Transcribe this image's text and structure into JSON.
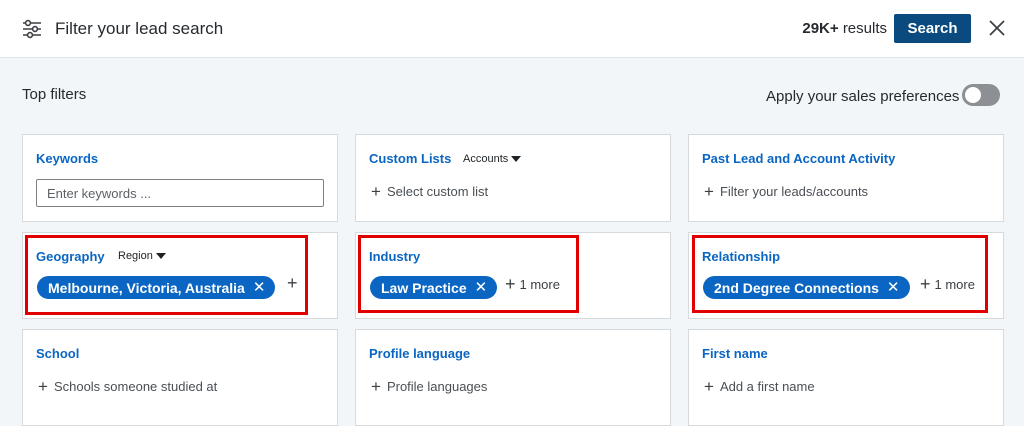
{
  "header": {
    "title": "Filter your lead search",
    "results_count": "29K+",
    "results_label": "results",
    "search_label": "Search"
  },
  "top": {
    "top_filters_label": "Top filters",
    "preferences_label": "Apply your sales preferences",
    "preferences_on": false
  },
  "cards": {
    "keywords": {
      "title": "Keywords",
      "placeholder": "Enter keywords ..."
    },
    "custom_lists": {
      "title": "Custom Lists",
      "dropdown": "Accounts",
      "add": "Select custom list"
    },
    "past_activity": {
      "title": "Past Lead and Account Activity",
      "add": "Filter your leads/accounts"
    },
    "geography": {
      "title": "Geography",
      "dropdown": "Region",
      "selected": "Melbourne, Victoria, Australia"
    },
    "industry": {
      "title": "Industry",
      "selected": "Law Practice",
      "more": "1 more"
    },
    "relationship": {
      "title": "Relationship",
      "selected": "2nd Degree Connections",
      "more": "1 more"
    },
    "school": {
      "title": "School",
      "add": "Schools someone studied at"
    },
    "profile_language": {
      "title": "Profile language",
      "add": "Profile languages"
    },
    "first_name": {
      "title": "First name",
      "add": "Add a first name"
    }
  },
  "colors": {
    "brand_blue": "#0a66c2",
    "button_blue": "#0a4a7e",
    "highlight_red": "#e00000"
  }
}
